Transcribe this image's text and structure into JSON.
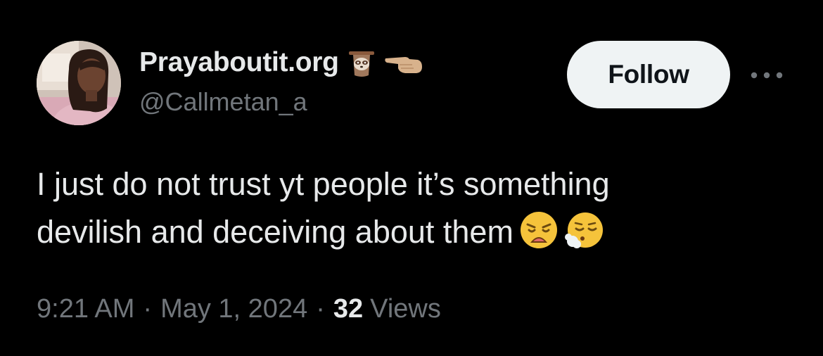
{
  "author": {
    "display_name": "Prayaboutit.org",
    "handle": "@Callmetan_a",
    "name_emojis": [
      "sloth-emoji",
      "backhand-index-pointing-left-emoji"
    ]
  },
  "actions": {
    "follow_label": "Follow",
    "more_icon": "more-horizontal-icon"
  },
  "tweet": {
    "line1": "I just do not trust yt people it’s something",
    "line2": "devilish and deceiving about them",
    "emojis": [
      "weary-face-emoji",
      "face-exhaling-emoji"
    ]
  },
  "meta": {
    "time": "9:21 AM",
    "separator": "·",
    "date": "May 1, 2024",
    "views_count": "32",
    "views_label": "Views"
  },
  "colors": {
    "background": "#000000",
    "primary_text": "#e7e9ea",
    "secondary_text": "#71767b",
    "follow_bg": "#eff3f4",
    "follow_text": "#0f1419"
  }
}
